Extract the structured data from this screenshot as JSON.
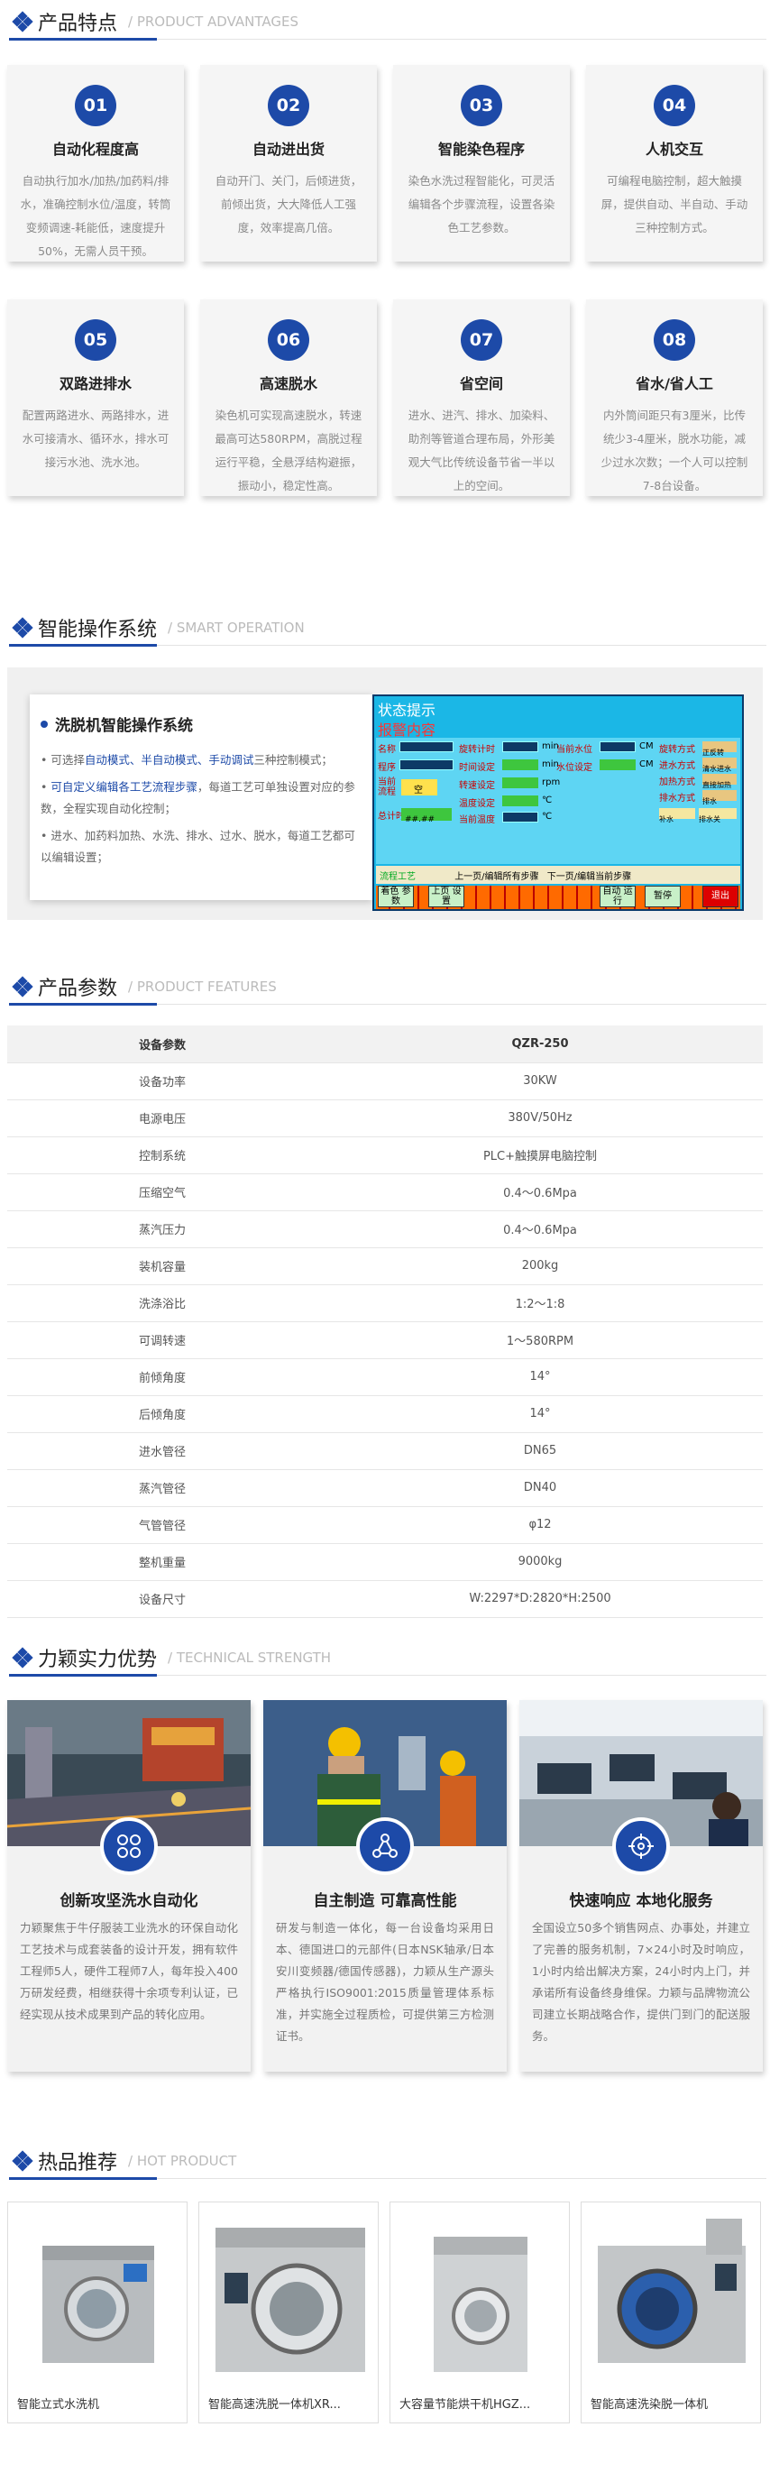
{
  "advantages": {
    "title": "产品特点",
    "subtitle": "/ PRODUCT ADVANTAGES",
    "items": [
      {
        "num": "01",
        "title": "自动化程度高",
        "desc": "自动执行加水/加热/加药料/排水，准确控制水位/温度，转筒变频调速-耗能低，速度提升50%，无需人员干预。"
      },
      {
        "num": "02",
        "title": "自动进出货",
        "desc": "自动开门、关门，后倾进货，前倾出货，大大降低人工强度，效率提高几倍。"
      },
      {
        "num": "03",
        "title": "智能染色程序",
        "desc": "染色水洗过程智能化，可灵活编辑各个步骤流程，设置各染色工艺参数。"
      },
      {
        "num": "04",
        "title": "人机交互",
        "desc": "可编程电脑控制，超大触摸屏，提供自动、半自动、手动三种控制方式。"
      },
      {
        "num": "05",
        "title": "双路进排水",
        "desc": "配置两路进水、两路排水，进水可接清水、循环水，排水可接污水池、洗水池。"
      },
      {
        "num": "06",
        "title": "高速脱水",
        "desc": "染色机可实现高速脱水，转速最高可达580RPM，高脱过程运行平稳，全悬浮结构避振，振动小，稳定性高。"
      },
      {
        "num": "07",
        "title": "省空间",
        "desc": "进水、进汽、排水、加染料、助剂等管道合理布局，外形美观大气比传统设备节省一半以上的空间。"
      },
      {
        "num": "08",
        "title": "省水/省人工",
        "desc": "内外筒间距只有3厘米，比传统少3-4厘米，脱水功能，减少过水次数；一个人可以控制7-8台设备。"
      }
    ]
  },
  "operation": {
    "title": "智能操作系统",
    "subtitle": "/ SMART OPERATION",
    "card_title": "洗脱机智能操作系统",
    "bullets": [
      {
        "pre": "• 可选择",
        "hl": "自动模式、半自动模式、手动调试",
        "post": "三种控制模式；"
      },
      {
        "pre": "• ",
        "hl": "可自定义编辑各工艺流程步骤",
        "post": "，每道工艺可单独设置对应的参数，全程实现自动化控制；"
      },
      {
        "pre": "• 进水、加药料加热、水洗、排水、过水、脱水，每道工艺都可以编辑设置；",
        "hl": "",
        "post": ""
      }
    ],
    "panel": {
      "status": "状态提示",
      "alarm": "报警内容",
      "labels": [
        "名称",
        "程序",
        "当前流程",
        "总计时",
        "旋转计时",
        "时间设定",
        "转速设定",
        "温度设定",
        "当前温度",
        "当前水位",
        "水位设定",
        "旋转方式",
        "进水方式",
        "加热方式",
        "排水方式",
        "min",
        "min",
        "rpm",
        "℃",
        "℃",
        "CM",
        "CM",
        "空",
        "##.##",
        "正反转",
        "清水进水",
        "直接加热",
        "排水",
        "补水",
        "排水关"
      ],
      "flow_label": "流程工艺",
      "flow_tabs": [
        "上一页/编辑所有步骤",
        "下一页/编辑当前步骤"
      ],
      "buttons": [
        "着色\n参数",
        "上页\n设置",
        "自动\n运行",
        "暂停",
        "退出"
      ]
    }
  },
  "features": {
    "title": "产品参数",
    "subtitle": "/ PRODUCT FEATURES",
    "header": {
      "k": "设备参数",
      "v": "QZR-250"
    },
    "rows": [
      {
        "k": "设备功率",
        "v": "30KW"
      },
      {
        "k": "电源电压",
        "v": "380V/50Hz"
      },
      {
        "k": "控制系统",
        "v": "PLC+触摸屏电脑控制"
      },
      {
        "k": "压缩空气",
        "v": "0.4～0.6Mpa"
      },
      {
        "k": "蒸汽压力",
        "v": "0.4～0.6Mpa"
      },
      {
        "k": "装机容量",
        "v": "200kg"
      },
      {
        "k": "洗涤浴比",
        "v": "1:2～1:8"
      },
      {
        "k": "可调转速",
        "v": "1～580RPM"
      },
      {
        "k": "前倾角度",
        "v": "14°"
      },
      {
        "k": "后倾角度",
        "v": "14°"
      },
      {
        "k": "进水管径",
        "v": "DN65"
      },
      {
        "k": "蒸汽管径",
        "v": "DN40"
      },
      {
        "k": "气管管径",
        "v": "φ12"
      },
      {
        "k": "整机重量",
        "v": "9000kg"
      },
      {
        "k": "设备尺寸",
        "v": "W:2297*D:2820*H:2500"
      }
    ]
  },
  "strength": {
    "title": "力颖实力优势",
    "subtitle": "/ TECHNICAL STRENGTH",
    "items": [
      {
        "icon": "grid-icon",
        "title": "创新攻坚洗水自动化",
        "desc": "力颖聚焦于牛仔服装工业洗水的环保自动化工艺技术与成套装备的设计开发，拥有软件工程师5人，硬件工程师7人，每年投入400万研发经费，相继获得十余项专利认证，已经实现从技术成果到产品的转化应用。"
      },
      {
        "icon": "network-icon",
        "title": "自主制造 可靠高性能",
        "desc": "研发与制造一体化，每一台设备均采用日本、德国进口的元部件(日本NSK轴承/日本安川变频器/德国传感器)，力颖从生产源头严格执行ISO9001:2015质量管理体系标准，并实施全过程质检，可提供第三方检测证书。"
      },
      {
        "icon": "target-icon",
        "title": "快速响应 本地化服务",
        "desc": "全国设立50多个销售网点、办事处，并建立了完善的服务机制，7×24小时及时响应，1小时内给出解决方案，24小时内上门，并承诺所有设备终身维保。力颖与品牌物流公司建立长期战略合作，提供门到门的配送服务。"
      }
    ]
  },
  "hot": {
    "title": "热品推荐",
    "subtitle": "/ HOT PRODUCT",
    "items": [
      {
        "name": "智能立式水洗机"
      },
      {
        "name": "智能高速洗脱一体机XR..."
      },
      {
        "name": "大容量节能烘干机HGZ..."
      },
      {
        "name": "智能高速洗染脱一体机"
      }
    ]
  }
}
